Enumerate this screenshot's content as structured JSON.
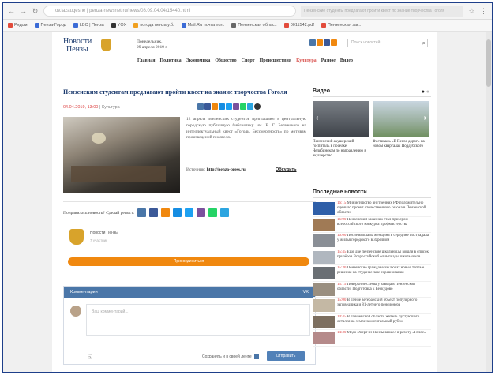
{
  "browser": {
    "url": "ov.lazaugesne | penza-newsnet.ru/news/08.09.04.04/15440.html",
    "ext_text": "Пензенские студенты предлагают пройти квест по знание творчества Гоголя",
    "bookmarks": [
      {
        "label": "Рядом",
        "color": "#e24b3b"
      },
      {
        "label": "Пенза-Город",
        "color": "#3b6bd6"
      },
      {
        "label": "LBC | Пенза",
        "color": "#3b6bd6"
      },
      {
        "label": "YOX",
        "color": "#333333"
      },
      {
        "label": "погода пенза у.б.",
        "color": "#f0a020"
      },
      {
        "label": "Mail.Ru почта пол.",
        "color": "#3b6bd6"
      },
      {
        "label": "Пензенская облас..",
        "color": "#666666"
      },
      {
        "label": "0011542.pdf",
        "color": "#e24b3b"
      },
      {
        "label": "Пензенская зак..",
        "color": "#e24b3b"
      }
    ]
  },
  "site": {
    "logo_line1": "Новости",
    "logo_line2": "Пензы",
    "date_line1": "Понедельник,",
    "date_line2": "29 апреля 2019 г.",
    "search_placeholder": "Поиск новостей",
    "menu": [
      "Главная",
      "Политика",
      "Экономика",
      "Общество",
      "Спорт",
      "Происшествия",
      "Культура",
      "Разное",
      "Видео"
    ],
    "menu_active": "Культура"
  },
  "article": {
    "title": "Пензенским студентам предлагают пройти квест на знание творчества Гоголя",
    "date": "04.04.2019, 13:00",
    "category": "Культура",
    "text": "12 апреля пензенских студентов приглашают в центральную городскую публичную библиотеку им. В. Г. Белинского на интеллектуальный квест «Гоголь. Бессмертность» по мотивам произведений писателя.",
    "source_label": "Источник:",
    "source_value": "http://penza-press.ru",
    "discuss": "Обсудить"
  },
  "share_prompt": "Понравилась новость? Сделай репост:",
  "group": {
    "name": "Новости Пензы",
    "subtitle": "7 участник",
    "join_label": "Присоединиться"
  },
  "comments": {
    "header": "Комментарии",
    "header_right": "VK",
    "placeholder": "Ваш комментарий...",
    "post_to_page": "Сохранять и в своей ленте",
    "send_label": "Отправить"
  },
  "sidebar": {
    "video_title": "Видео",
    "videos": [
      {
        "caption": "Пензенский акушерский госпиталь в посёлке Челябинском по направлению в акушерство"
      },
      {
        "caption": "Фестиваль «В Пензе дорог» на новом кварталах Поддубского"
      }
    ],
    "news_title": "Последние новости",
    "news": [
      {
        "time": "16:15",
        "text": "Министерство внутренних РФ положительно оценило проект отечественного сезона в Пензенской области"
      },
      {
        "time": "16:00",
        "text": "Пензенский заказник стал призером всероссийского конкурса профмастерства"
      },
      {
        "time": "16:00",
        "text": "После выплаты женщина в середине пострадала у жилья городского в Заречном"
      },
      {
        "time": "15:45",
        "text": "Еще две пензенские школьницы вошли в список призёров Всероссийской олимпиады школьников"
      },
      {
        "time": "15:30",
        "text": "Пензенские граждане заключат новые теплые решения на студенческие соревнования"
      },
      {
        "time": "15:15",
        "text": "Поверхние схемы у завода в Пензенской области: Подготовка к Бескудово"
      },
      {
        "time": "15:00",
        "text": "В Пензе ветеранский объект популярного заповедника и 81-летнего пенсионера"
      },
      {
        "time": "14:45",
        "text": "В Пензенской области житель пустующего остался на земле зажигательный рубеж"
      },
      {
        "time": "14:30",
        "text": "Медо Энерт из Пензы вышел в работу «Голос»"
      }
    ]
  },
  "colors": {
    "brand_blue": "#1c3b6e",
    "vk_blue": "#4a76a8",
    "join_orange": "#f0880f",
    "accent_red": "#d9534f",
    "frame": "#1e3f8a"
  }
}
